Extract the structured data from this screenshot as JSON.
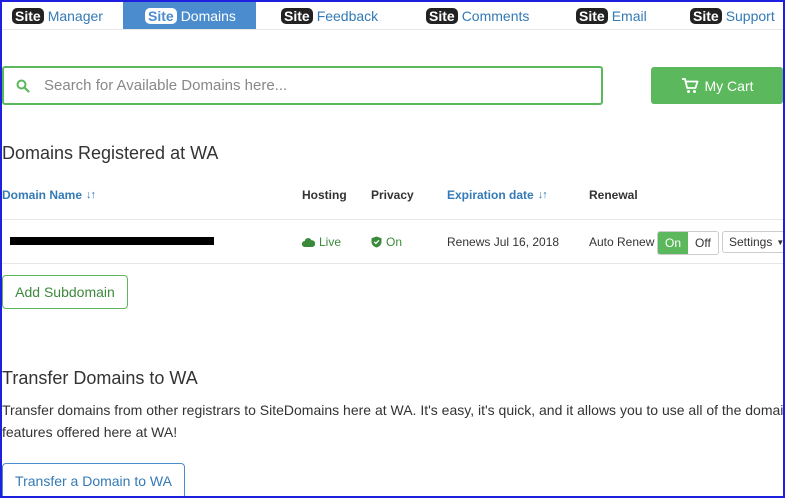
{
  "nav": {
    "badge": "Site",
    "tabs": [
      {
        "label": "Manager",
        "active": false
      },
      {
        "label": "Domains",
        "active": true
      },
      {
        "label": "Feedback",
        "active": false
      },
      {
        "label": "Comments",
        "active": false
      },
      {
        "label": "Email",
        "active": false
      },
      {
        "label": "Support",
        "active": false
      }
    ]
  },
  "search": {
    "placeholder": "Search for Available Domains here...",
    "value": ""
  },
  "cart": {
    "label": "My Cart",
    "icon": "cart-icon"
  },
  "registered": {
    "title": "Domains Registered at WA",
    "columns": {
      "domain": "Domain Name",
      "hosting": "Hosting",
      "privacy": "Privacy",
      "expiration": "Expiration date",
      "renewal": "Renewal"
    },
    "row": {
      "domain": "",
      "hosting": "Live",
      "privacy": "On",
      "expiration": "Renews Jul 16, 2018",
      "renewal_label": "Auto Renew",
      "toggle_on": "On",
      "toggle_off": "Off",
      "settings": "Settings"
    },
    "add_subdomain": "Add Subdomain"
  },
  "transfer": {
    "title": "Transfer Domains to WA",
    "text": "Transfer domains from other registrars to SiteDomains here at WA. It's easy, it's quick, and it allows you to use all of the domain features offered here at WA!",
    "button": "Transfer a Domain to WA"
  },
  "colors": {
    "accent_green": "#5cb85c",
    "link_blue": "#337ab7",
    "active_tab": "#4b8ccf"
  }
}
